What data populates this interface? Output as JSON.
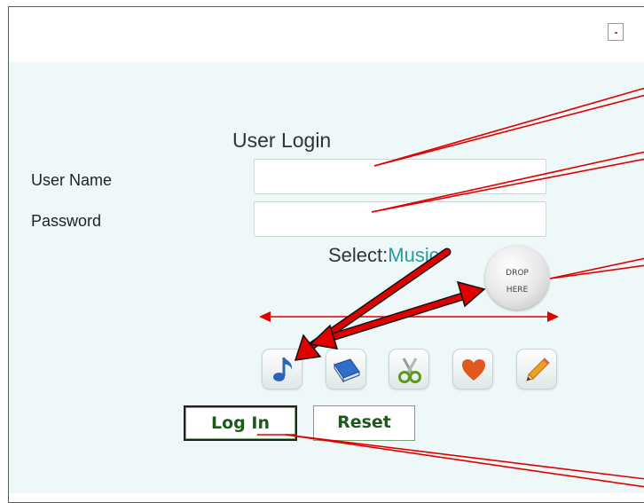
{
  "form": {
    "title": "User Login",
    "username_label": "User Name",
    "username_value": "",
    "password_label": "Password",
    "password_value": "",
    "select_prefix": "Select:",
    "select_value": "Music"
  },
  "drop_target": {
    "line1": "DROP",
    "line2": "HERE"
  },
  "categories": [
    {
      "name": "music",
      "icon": "music-note-icon"
    },
    {
      "name": "book",
      "icon": "book-icon"
    },
    {
      "name": "scissors",
      "icon": "scissors-icon"
    },
    {
      "name": "heart",
      "icon": "heart-icon"
    },
    {
      "name": "pencil",
      "icon": "pencil-icon"
    }
  ],
  "buttons": {
    "login": "Log In",
    "reset": "Reset"
  },
  "colors": {
    "annotation": "#e00000",
    "accent": "#2a9b9b",
    "button_text": "#1c5a1c",
    "background": "#eef8f8"
  }
}
